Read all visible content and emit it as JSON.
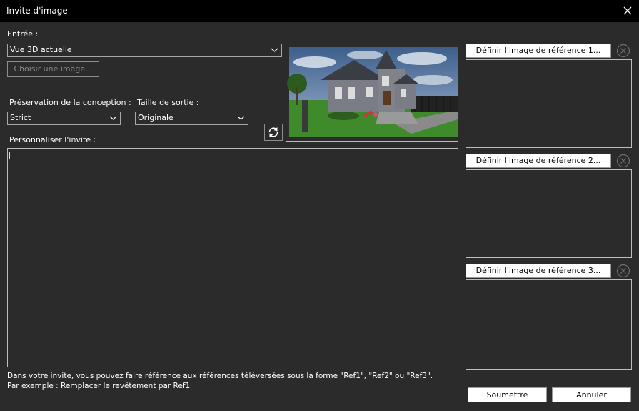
{
  "window": {
    "title": "Invite d'image"
  },
  "input_section": {
    "label": "Entrée :",
    "source_value": "Vue 3D actuelle",
    "choose_image_label": "Choisir une image..."
  },
  "design_preservation": {
    "label": "Préservation de la conception :",
    "value": "Strict"
  },
  "output_size": {
    "label": "Taille de sortie :",
    "value": "Originale"
  },
  "prompt": {
    "label": "Personnaliser l'invite :",
    "value": ""
  },
  "references": [
    {
      "button_label": "Définir l'image de référence 1..."
    },
    {
      "button_label": "Définir l'image de référence 2..."
    },
    {
      "button_label": "Définir l'image de référence 3..."
    }
  ],
  "hint": {
    "line1": "Dans votre invite, vous pouvez faire référence aux références téléversées sous la forme \"Ref1\", \"Ref2\" ou \"Ref3\".",
    "line2": "Par exemple : Remplacer le revêtement par Ref1"
  },
  "actions": {
    "submit_label": "Soumettre",
    "cancel_label": "Annuler"
  },
  "icons": {
    "close": "close-icon",
    "refresh": "refresh-icon",
    "chevron": "chevron-down-icon",
    "clear": "clear-circle-icon"
  },
  "colors": {
    "background": "#2b2b2b",
    "titlebar": "#000000",
    "border": "#bdbdbd"
  }
}
